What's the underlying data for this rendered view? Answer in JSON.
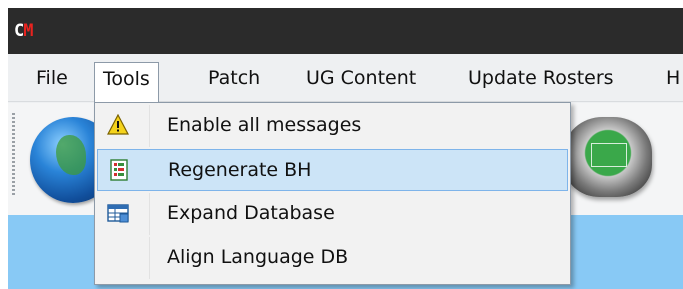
{
  "app": {
    "logo_c": "C",
    "logo_m": "M"
  },
  "menubar": {
    "items": [
      {
        "label": "File"
      },
      {
        "label": "Tools"
      },
      {
        "label": "Patch"
      },
      {
        "label": "UG Content"
      },
      {
        "label": "Update Rosters"
      },
      {
        "label": "H"
      }
    ],
    "active": "Tools"
  },
  "tools_menu": {
    "items": [
      {
        "label": "Enable all messages",
        "icon": "warning-icon"
      },
      {
        "label": "Regenerate BH",
        "icon": "document-icon",
        "highlighted": true
      },
      {
        "label": "Expand Database",
        "icon": "database-table-icon"
      },
      {
        "label": "Align Language DB",
        "icon": ""
      }
    ]
  },
  "toolbar": {
    "icons": [
      "globe-icon",
      "stadium-icon"
    ]
  },
  "colors": {
    "titlebar": "#2b2b2b",
    "logo_m": "#e8231f",
    "highlight": "#cce4f7",
    "content": "#88c9f5"
  }
}
